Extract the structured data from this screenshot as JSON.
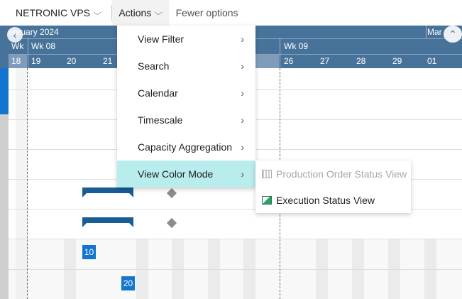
{
  "toolbar": {
    "vps_label": "NETRONIC VPS",
    "actions_label": "Actions",
    "fewer_label": "Fewer options"
  },
  "gantt": {
    "month_left": "ebruary 2024",
    "month_right": "Mar",
    "weeks": [
      "Wk",
      "Wk 08",
      "Wk 09"
    ],
    "days": [
      "18",
      "19",
      "20",
      "21",
      "26",
      "27",
      "28",
      "29",
      "01"
    ],
    "badges": [
      "10",
      "20"
    ]
  },
  "menu": {
    "items": [
      {
        "label": "View Filter"
      },
      {
        "label": "Search"
      },
      {
        "label": "Calendar"
      },
      {
        "label": "Timescale"
      },
      {
        "label": "Capacity Aggregation"
      },
      {
        "label": "View Color Mode"
      }
    ]
  },
  "submenu": {
    "items": [
      {
        "label": "Production Order Status View",
        "enabled": false
      },
      {
        "label": "Execution Status View",
        "enabled": true
      }
    ]
  }
}
